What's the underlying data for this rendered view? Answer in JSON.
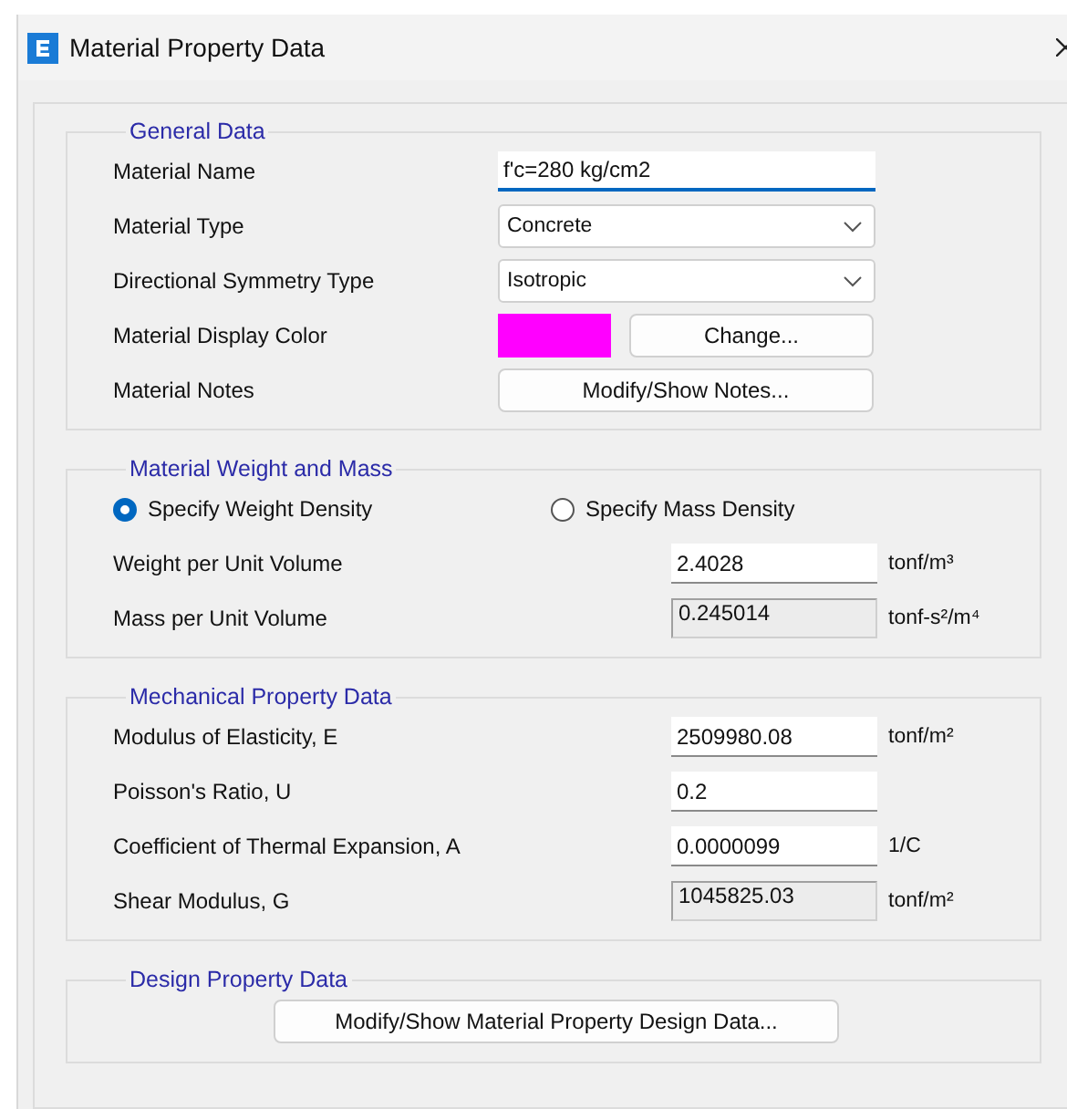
{
  "window": {
    "title": "Material Property Data"
  },
  "general_data": {
    "title": "General Data",
    "rows": [
      {
        "kind": "text",
        "label": "Material Name",
        "value": "f'c=280 kg/cm2",
        "focused": true
      },
      {
        "kind": "dropdown",
        "label": "Material Type",
        "value": "Concrete"
      },
      {
        "kind": "dropdown",
        "label": "Directional Symmetry Type",
        "value": "Isotropic"
      },
      {
        "kind": "color",
        "label": "Material Display Color",
        "color": "#ff00ff",
        "button": "Change..."
      },
      {
        "kind": "button",
        "label": "Material Notes",
        "button": "Modify/Show Notes..."
      }
    ]
  },
  "weight_and_mass": {
    "title": "Material Weight and Mass",
    "options": [
      {
        "label": "Specify Weight Density",
        "selected": true
      },
      {
        "label": "Specify Mass Density",
        "selected": false
      }
    ],
    "rows": [
      {
        "label": "Weight per Unit Volume",
        "value": "2.4028",
        "unit": "tonf/m³",
        "disabled": false
      },
      {
        "label": "Mass per Unit Volume",
        "value": "0.245014",
        "unit": "tonf-s²/m⁴",
        "disabled": true
      }
    ]
  },
  "mechanical_property_data": {
    "title": "Mechanical Property Data",
    "rows": [
      {
        "label": "Modulus of Elasticity,  E",
        "value": "2509980.08",
        "unit": "tonf/m²",
        "disabled": false
      },
      {
        "label": "Poisson's Ratio,  U",
        "value": "0.2",
        "disabled": false
      },
      {
        "label": "Coefficient of Thermal Expansion,  A",
        "value": "0.0000099",
        "unit": "1/C",
        "disabled": false
      },
      {
        "label": "Shear Modulus,  G",
        "value": "1045825.03",
        "unit": "tonf/m²",
        "disabled": true
      }
    ]
  },
  "design_property_data": {
    "title": "Design Property Data",
    "button": "Modify/Show Material Property Design Data..."
  }
}
